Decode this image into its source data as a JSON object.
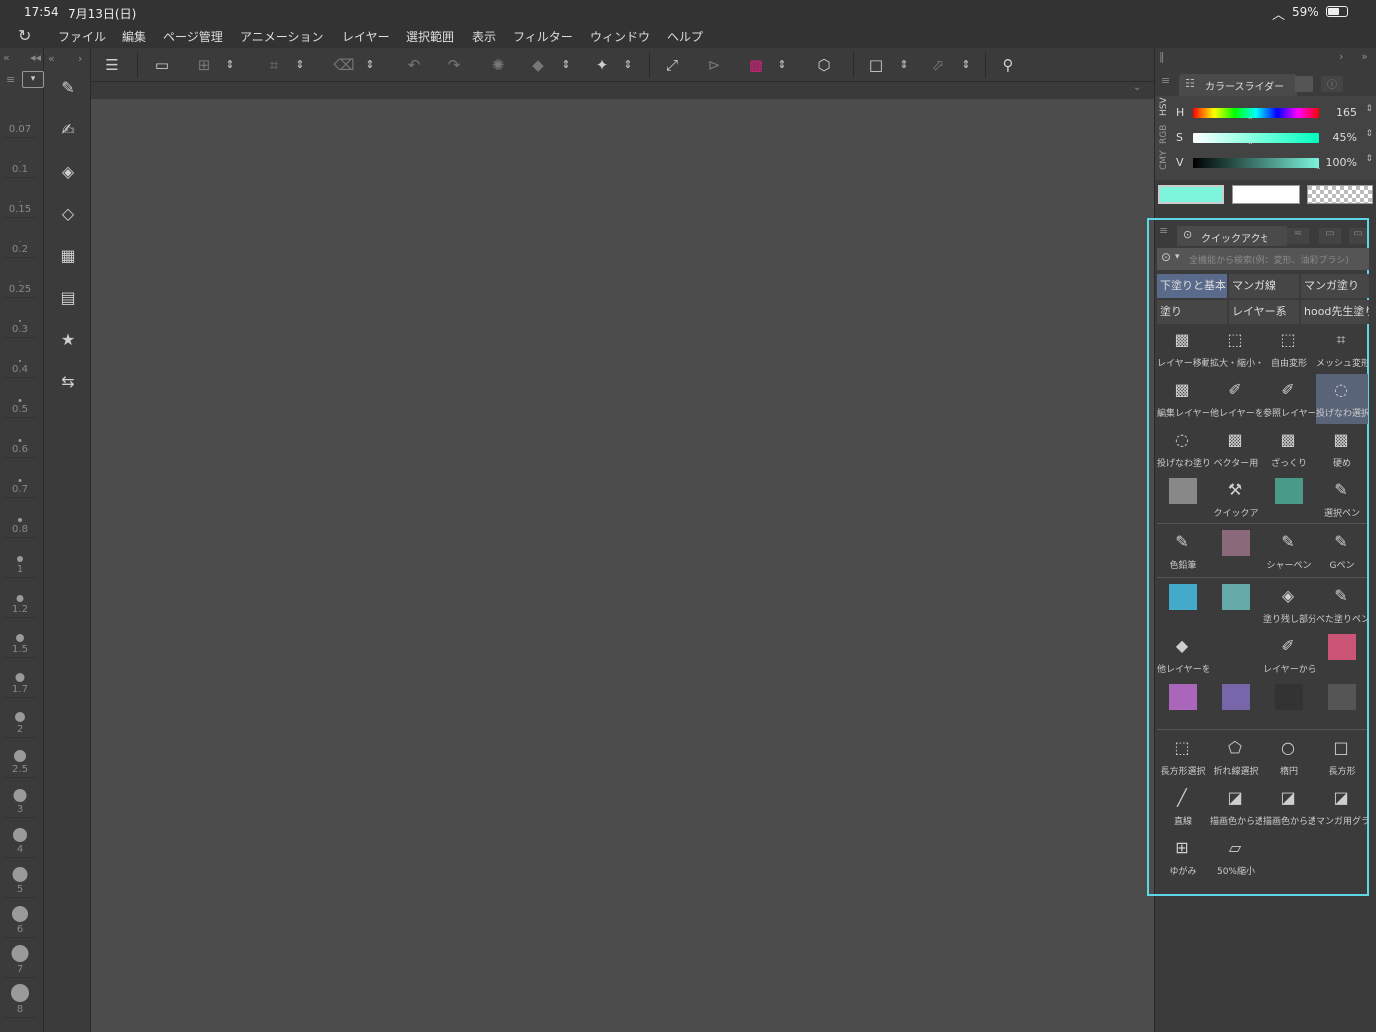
{
  "status": {
    "time": "17:54",
    "date": "7月13日(日)",
    "battery": "59%"
  },
  "menu": [
    "ファイル",
    "編集",
    "ページ管理",
    "アニメーション",
    "レイヤー",
    "選択範囲",
    "表示",
    "フィルター",
    "ウィンドウ",
    "ヘルプ"
  ],
  "brush_sizes": [
    "0.07",
    "0.1",
    "0.15",
    "0.2",
    "0.25",
    "0.3",
    "0.4",
    "0.5",
    "0.6",
    "0.7",
    "0.8",
    "1",
    "1.2",
    "1.5",
    "1.7",
    "2",
    "2.5",
    "3",
    "4",
    "5",
    "6",
    "7",
    "8"
  ],
  "color_slider": {
    "tab_title": "カラースライダー",
    "modes": [
      "HSV",
      "RGB",
      "CMY"
    ],
    "h": {
      "label": "H",
      "value": "165"
    },
    "s": {
      "label": "S",
      "value": "45%"
    },
    "v": {
      "label": "V",
      "value": "100%"
    },
    "main_color": "#7cf5dc",
    "sub_color": "#ffffff"
  },
  "quick_access": {
    "tab_title": "クイックアクセス",
    "search_placeholder": "全機能から検索(例：変形、油彩ブラシ)",
    "sets": [
      "下塗りと基本",
      "マンガ線",
      "マンガ塗り",
      "塗り",
      "レイヤー系",
      "hood先生塗り"
    ],
    "items": [
      "レイヤー移動",
      "拡大・縮小・",
      "自由変形",
      "メッシュ変形",
      "編集レイヤー",
      "他レイヤーを",
      "参照レイヤー",
      "投げなわ選択",
      "投げなわ塗り",
      "ベクター用",
      "ざっくり",
      "硬め",
      "",
      "クイックア",
      "",
      "選択ペン",
      "色鉛筆",
      "",
      "シャーペン",
      "Gペン",
      "",
      "",
      "塗り残し部分",
      "べた塗りペン",
      "他レイヤーを",
      "",
      "レイヤーから",
      "",
      "",
      "",
      "",
      "",
      "長方形選択",
      "折れ線選択",
      "楕円",
      "長方形",
      "直線",
      "描画色から透",
      "描画色から透",
      "マンガ用グラ",
      "ゆがみ",
      "50%縮小"
    ]
  }
}
